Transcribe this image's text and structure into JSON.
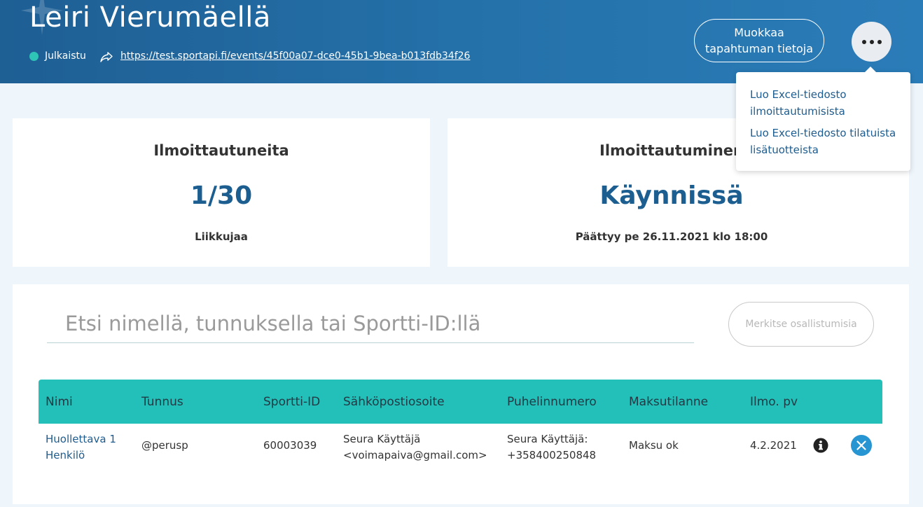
{
  "header": {
    "title": "Leiri Vierumäellä",
    "status": "Julkaistu",
    "event_url": "https://test.sportapi.fi/events/45f00a07-dce0-45b1-9bea-b013fdb34f26",
    "edit_button": "Muokkaa tapahtuman tietoja",
    "status_color": "#2ec4b6"
  },
  "menu": {
    "items": [
      {
        "label": "Luo Excel-tiedosto ilmoittautumisista"
      },
      {
        "label": "Luo Excel-tiedosto tilatuista lisätuotteista"
      }
    ]
  },
  "cards": {
    "registered": {
      "label": "Ilmoittautuneita",
      "value": "1/30",
      "sub": "Liikkujaa"
    },
    "registration": {
      "label": "Ilmoittautuminen",
      "value": "Käynnissä",
      "sub": "Päättyy pe 26.11.2021 klo 18:00"
    }
  },
  "search": {
    "placeholder": "Etsi nimellä, tunnuksella tai Sportti-ID:llä",
    "mark_button": "Merkitse osallistumisia"
  },
  "table": {
    "columns": [
      "Nimi",
      "Tunnus",
      "Sportti-ID",
      "Sähköpostiosoite",
      "Puhelinnumero",
      "Maksutilanne",
      "Ilmo. pv"
    ],
    "rows": [
      {
        "name_line1": "Huollettava 1",
        "name_line2": "Henkilö",
        "username": "@perusp",
        "sportti_id": "60003039",
        "email_line1": "Seura Käyttäjä",
        "email_line2": "<voimapaiva@gmail.com>",
        "phone_line1": "Seura Käyttäjä:",
        "phone_line2": "+358400250848",
        "payment": "Maksu ok",
        "date": "4.2.2021"
      }
    ],
    "header_color": "#22c0b8"
  }
}
